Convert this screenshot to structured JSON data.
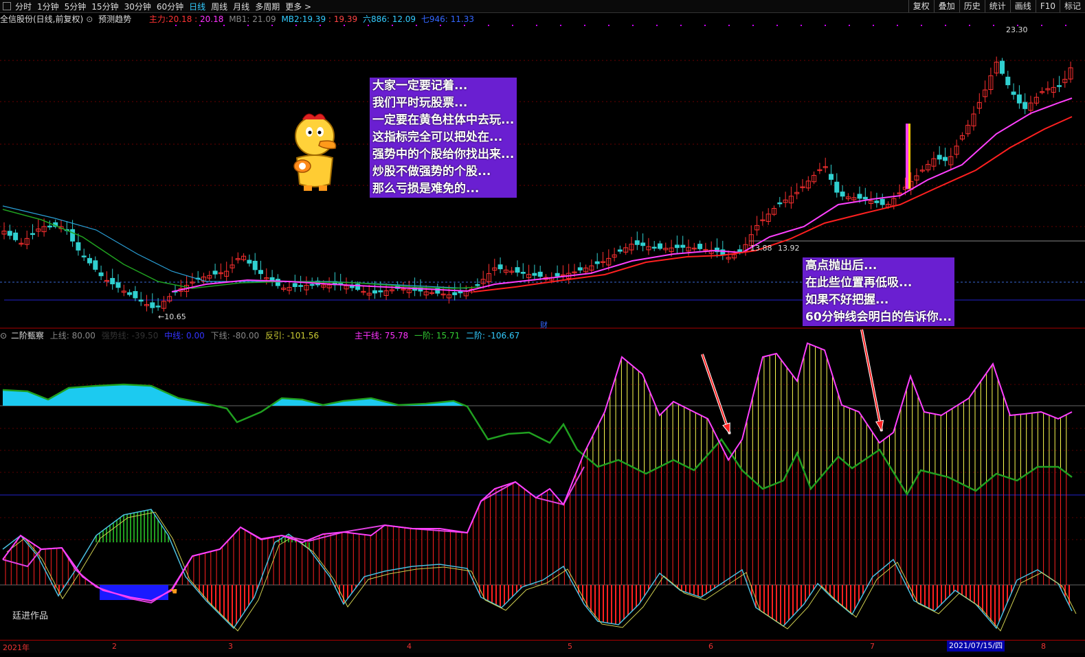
{
  "toolbar": {
    "periods": [
      "分时",
      "1分钟",
      "5分钟",
      "15分钟",
      "30分钟",
      "60分钟",
      "日线",
      "周线",
      "月线",
      "多周期",
      "更多 >"
    ],
    "active_period": "日线",
    "right_buttons": [
      "复权",
      "叠加",
      "历史",
      "统计",
      "画线",
      "F10",
      "标记"
    ]
  },
  "info": {
    "stock": "全信股份(日线,前复权)",
    "predict": "预测趋势",
    "zl_label": "主力:",
    "zl_value": "20.18",
    "zl_value2": "20.18",
    "mb1": "MB1: 21.09",
    "mb2_label": "MB2:",
    "mb2_value": "19.39",
    "mb2_value2": "19.39",
    "l886": "六886: 12.09",
    "l946": "七946: 11.33"
  },
  "indicator": {
    "name": "二阶甄察",
    "up": "上线: 80.00",
    "strong": "强势线: -39.50",
    "mid": "中线: 0.00",
    "down": "下线: -80.00",
    "rev": "反引: -101.56",
    "main": "主干线: 75.78",
    "s1": "一阶: 15.71",
    "s2": "二阶: -106.67"
  },
  "annotations": {
    "left_callout": [
      "大家一定要记着...",
      "我们平时玩股票...",
      "一定要在黄色柱体中去玩...",
      "这指标完全可以把处在...",
      "强势中的个股给你找出来...",
      "炒股不做强势的个股...",
      "那么亏损是难免的..."
    ],
    "right_callout": [
      "高点抛出后...",
      "在此些位置再低吸...",
      "如果不好把握...",
      "60分钟线会明白的告诉你..."
    ],
    "author": "廷进作品",
    "cai": "财"
  },
  "price_labels": {
    "high": "23.30",
    "low": "10.65",
    "mid1": "13.88",
    "mid2": "13.92"
  },
  "dates": [
    "2021年",
    "2",
    "3",
    "4",
    "5",
    "6",
    "7",
    "8"
  ],
  "selected_date": "2021/07/15/四",
  "colors": {
    "up_candle": "#ff3030",
    "down_candle": "#30d0d0",
    "ma_pink": "#ff40ff",
    "ma_red": "#ff2020",
    "ma_green": "#20a020",
    "ma_blue": "#2a9fd6",
    "callout_bg": "#6a1fd1"
  },
  "chart_data": {
    "type": "candlestick",
    "price_range": [
      10.65,
      23.3
    ],
    "indicator_levels": {
      "up": 80,
      "strong": -39.5,
      "mid": 0,
      "down": -80
    }
  }
}
